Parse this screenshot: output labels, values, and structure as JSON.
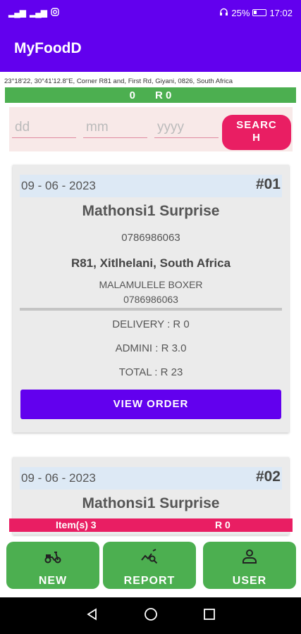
{
  "status_bar": {
    "left_icons": [
      "signal-icon",
      "signal-icon",
      "instagram-icon"
    ],
    "battery_percent": "25%",
    "time": "17:02"
  },
  "app": {
    "title": "MyFoodD"
  },
  "location_text": "23°18'22, 30°41'12.8\"E, Corner R81 and, First Rd, Giyani, 0826, South Africa",
  "summary": {
    "count": "0",
    "total": "R 0"
  },
  "search": {
    "day_placeholder": "dd",
    "month_placeholder": "mm",
    "year_placeholder": "yyyy",
    "button_line1": "SEARC",
    "button_line2": "H"
  },
  "orders": [
    {
      "date": "09 - 06 - 2023",
      "number": "#01",
      "customer": "Mathonsi1 Surprise",
      "phone": "0786986063",
      "address": "R81, Xitlhelani, South Africa",
      "shop": "MALAMULELE BOXER",
      "shop_phone": "0786986063",
      "delivery": "DELIVERY : R 0",
      "admin": "ADMINI : R 3.0",
      "total": "TOTAL : R 23",
      "button": "VIEW ORDER"
    },
    {
      "date": "09 - 06 - 2023",
      "number": "#02",
      "customer": "Mathonsi1 Surprise"
    }
  ],
  "cart_bar": {
    "items": "Item(s) 3",
    "total": "R 0"
  },
  "bottom_nav": [
    {
      "label": "NEW",
      "icon": "scooter-icon"
    },
    {
      "label": "REPORT",
      "icon": "chart-search-icon"
    },
    {
      "label": "USER",
      "icon": "user-icon"
    }
  ],
  "colors": {
    "primary": "#6200ee",
    "accent": "#e91e63",
    "success": "#4caf50"
  }
}
